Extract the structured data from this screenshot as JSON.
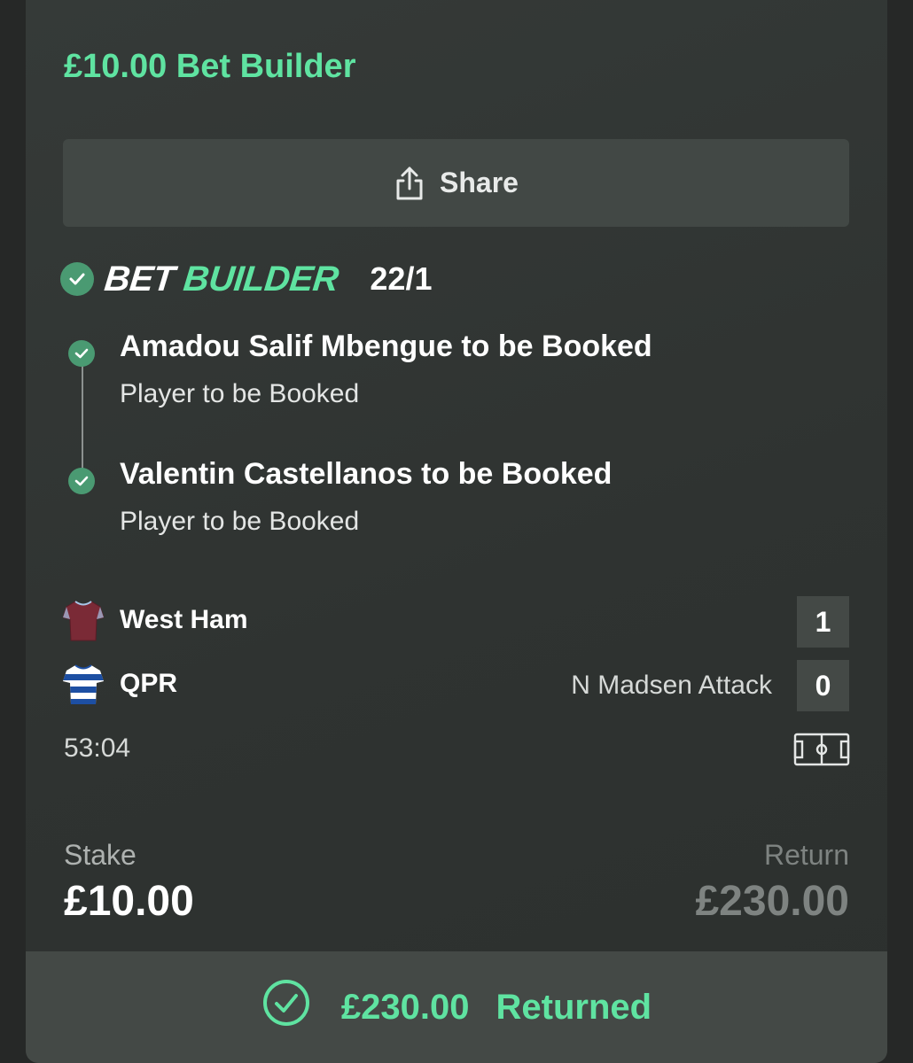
{
  "header": {
    "title": "£10.00 Bet Builder"
  },
  "share": {
    "label": "Share",
    "icon": "share-icon"
  },
  "bet_builder": {
    "logo_part1": "BET",
    "logo_part2": "BUILDER",
    "odds": "22/1",
    "status_icon": "check-circle-icon",
    "legs": [
      {
        "selection": "Amadou Salif Mbengue to be Booked",
        "market": "Player to be Booked"
      },
      {
        "selection": "Valentin Castellanos to be Booked",
        "market": "Player to be Booked"
      }
    ]
  },
  "match": {
    "home": {
      "name": "West Ham",
      "score": "1",
      "kit_icon": "west-ham-shirt-icon"
    },
    "away": {
      "name": "QPR",
      "score": "0",
      "kit_icon": "qpr-shirt-icon",
      "event": "N Madsen Attack"
    },
    "clock": "53:04",
    "pitch_icon": "pitch-icon"
  },
  "summary": {
    "stake_label": "Stake",
    "stake_value": "£10.00",
    "return_label": "Return",
    "return_value": "£230.00"
  },
  "result": {
    "amount": "£230.00",
    "label": "Returned",
    "icon": "check-circle-outline-icon"
  },
  "colors": {
    "accent": "#5fe3a1",
    "check_green": "#4a9a72",
    "card_bg": "#333836",
    "button_bg": "#424845"
  }
}
